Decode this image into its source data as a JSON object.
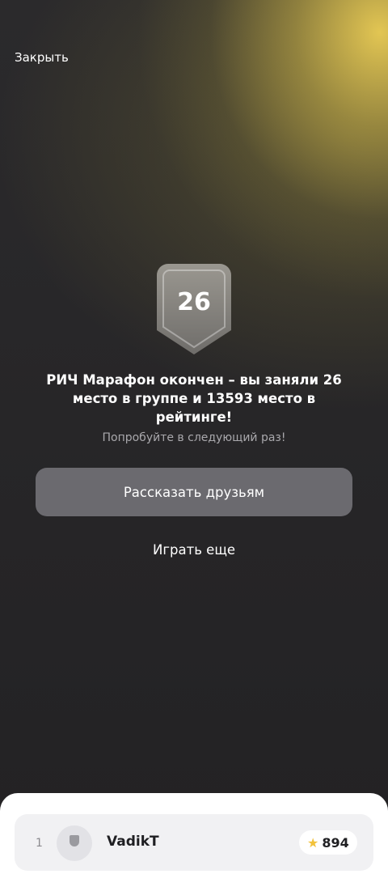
{
  "header": {
    "close_label": "Закрыть"
  },
  "result": {
    "place": "26",
    "title": "РИЧ Марафон окончен – вы заняли 26 место в группе и 13593 место в рейтинге!",
    "subtitle": "Попробуйте в следующий раз!"
  },
  "actions": {
    "share_label": "Рассказать друзьям",
    "play_again_label": "Играть еще"
  },
  "leaderboard": {
    "rows": [
      {
        "rank": "1",
        "name": "VadikT",
        "score": "894"
      }
    ]
  },
  "colors": {
    "background": "#262527",
    "glow": "#EBCD55",
    "button": "#6B6A6F",
    "subtitle": "#A9A8AC",
    "star": "#F2C23B"
  },
  "icons": {
    "badge": "shield-badge-icon",
    "avatar": "user-avatar-icon",
    "score": "star-icon"
  }
}
